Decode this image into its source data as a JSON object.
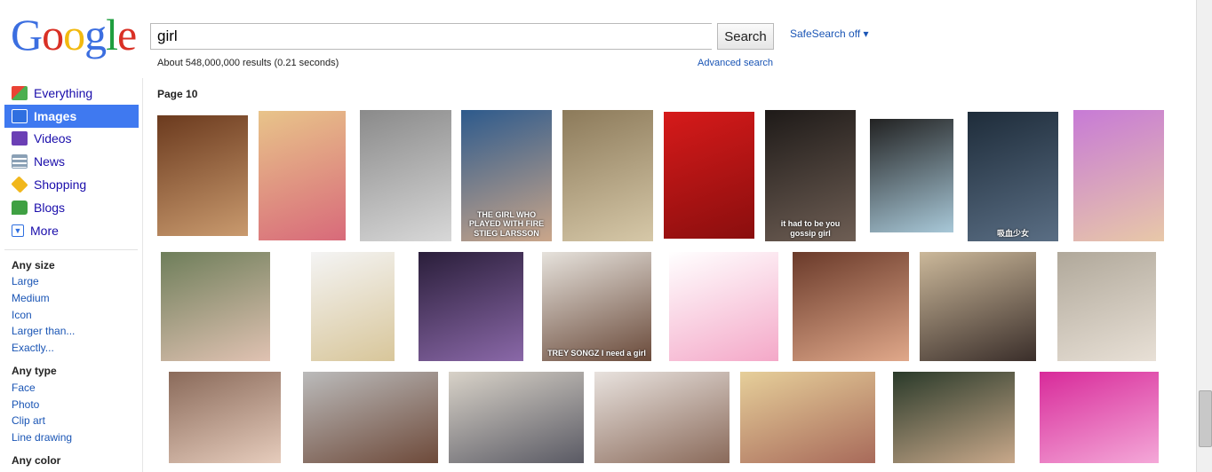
{
  "logo": "Google",
  "search": {
    "query": "girl",
    "button": "Search"
  },
  "safesearch": "SafeSearch off ▾",
  "result_stats": "About 548,000,000 results (0.21 seconds)",
  "advanced_search": "Advanced search",
  "nav": [
    {
      "label": "Everything",
      "icon": "everything-icon",
      "color": "#4caf50",
      "selected": false
    },
    {
      "label": "Images",
      "icon": "images-icon",
      "color": "#2f6fe0",
      "selected": true
    },
    {
      "label": "Videos",
      "icon": "videos-icon",
      "color": "#6b3fb5",
      "selected": false
    },
    {
      "label": "News",
      "icon": "news-icon",
      "color": "#8aa0b5",
      "selected": false
    },
    {
      "label": "Shopping",
      "icon": "shopping-icon",
      "color": "#f1b71c",
      "selected": false
    },
    {
      "label": "Blogs",
      "icon": "blogs-icon",
      "color": "#3fa043",
      "selected": false
    },
    {
      "label": "More",
      "icon": "more-icon",
      "color": "#2f6fe0",
      "selected": false
    }
  ],
  "filters": {
    "size": {
      "heading": "Any size",
      "options": [
        "Large",
        "Medium",
        "Icon",
        "Larger than...",
        "Exactly..."
      ]
    },
    "type": {
      "heading": "Any type",
      "options": [
        "Face",
        "Photo",
        "Clip art",
        "Line drawing"
      ]
    },
    "color": {
      "heading": "Any color"
    }
  },
  "page_label": "Page 10",
  "thumbnails": [
    {
      "name": "thumb-emo-girl",
      "colors": [
        "#6b3a1e",
        "#c99a6e"
      ]
    },
    {
      "name": "thumb-blonde-toddler",
      "colors": [
        "#e8c48a",
        "#d86a7a"
      ]
    },
    {
      "name": "thumb-girl-with-dog",
      "colors": [
        "#8a8a8a",
        "#d8d8d8"
      ]
    },
    {
      "name": "thumb-book-cover",
      "colors": [
        "#2d5a8c",
        "#caa68a"
      ],
      "caption": "THE GIRL WHO PLAYED WITH FIRE  STIEG LARSSON"
    },
    {
      "name": "thumb-cubist-painting",
      "colors": [
        "#8c7a5a",
        "#d6c8a8"
      ]
    },
    {
      "name": "thumb-red-pose",
      "colors": [
        "#d61a1a",
        "#8a0e0e"
      ]
    },
    {
      "name": "thumb-gossip-girl",
      "colors": [
        "#1e1a18",
        "#6e5e54"
      ],
      "caption": "it had to be you  gossip girl"
    },
    {
      "name": "thumb-pinup-scooter",
      "colors": [
        "#222",
        "#a8c8d8"
      ]
    },
    {
      "name": "thumb-movie-poster",
      "colors": [
        "#1e2c3a",
        "#5a6e84"
      ],
      "caption": "吸血少女"
    },
    {
      "name": "thumb-cartoon-girl",
      "colors": [
        "#c77ad6",
        "#e8c8a8"
      ]
    },
    {
      "name": "thumb-two-friends",
      "colors": [
        "#6e7e5a",
        "#e0c2b2"
      ]
    },
    {
      "name": "thumb-perfume",
      "colors": [
        "#f4f4f4",
        "#d8c69a"
      ]
    },
    {
      "name": "thumb-anime",
      "colors": [
        "#2a1e3a",
        "#8a68a8"
      ]
    },
    {
      "name": "thumb-trey-songz",
      "colors": [
        "#e6e2dc",
        "#6a4a3a"
      ],
      "caption": "TREY SONGZ  I need a girl"
    },
    {
      "name": "thumb-pink-balloons",
      "colors": [
        "#fff",
        "#f4a8c8"
      ]
    },
    {
      "name": "thumb-couple",
      "colors": [
        "#6a3a2a",
        "#e0a88a"
      ]
    },
    {
      "name": "thumb-sofa-girl",
      "colors": [
        "#cbb89a",
        "#3a2e2a"
      ]
    },
    {
      "name": "thumb-walking-girls",
      "colors": [
        "#b0a89a",
        "#e8e0d6"
      ]
    },
    {
      "name": "thumb-lying-girl",
      "colors": [
        "#8a6a5a",
        "#e6ccbc"
      ]
    },
    {
      "name": "thumb-child-bed",
      "colors": [
        "#bbb",
        "#6e4a3a"
      ]
    },
    {
      "name": "thumb-group-photo",
      "colors": [
        "#d8d2c8",
        "#5a5a64"
      ]
    },
    {
      "name": "thumb-asian-pair",
      "colors": [
        "#e8e2de",
        "#8a6a5a"
      ]
    },
    {
      "name": "thumb-two-blondes",
      "colors": [
        "#e6cf9a",
        "#a86a5a"
      ]
    },
    {
      "name": "thumb-funny-face",
      "colors": [
        "#2a3a2a",
        "#c8a88a"
      ]
    },
    {
      "name": "thumb-pink-dresses",
      "colors": [
        "#d82a9a",
        "#f4a8d8"
      ]
    }
  ],
  "colors": {
    "link": "#1a0dab",
    "selected_nav": "#3f79f0"
  }
}
